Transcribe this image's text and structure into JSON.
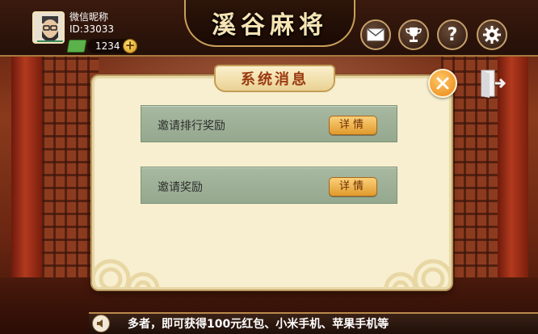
{
  "game": {
    "title": "溪谷麻将"
  },
  "user": {
    "name": "微信昵称",
    "id": "ID:33033",
    "coins": "1234",
    "add_symbol": "+"
  },
  "top_buttons": {
    "help_glyph": "?"
  },
  "dialog": {
    "title": "系统消息",
    "messages": [
      {
        "text": "邀请排行奖励",
        "button": "详情"
      },
      {
        "text": "邀请奖励",
        "button": "详情"
      }
    ]
  },
  "ticker": {
    "text": "多者，即可获得100元红包、小米手机、苹果手机等"
  },
  "colors": {
    "accent": "#e98612",
    "panel": "#f7efcf",
    "row": "#9fb299",
    "title_text": "#9a3b10"
  }
}
